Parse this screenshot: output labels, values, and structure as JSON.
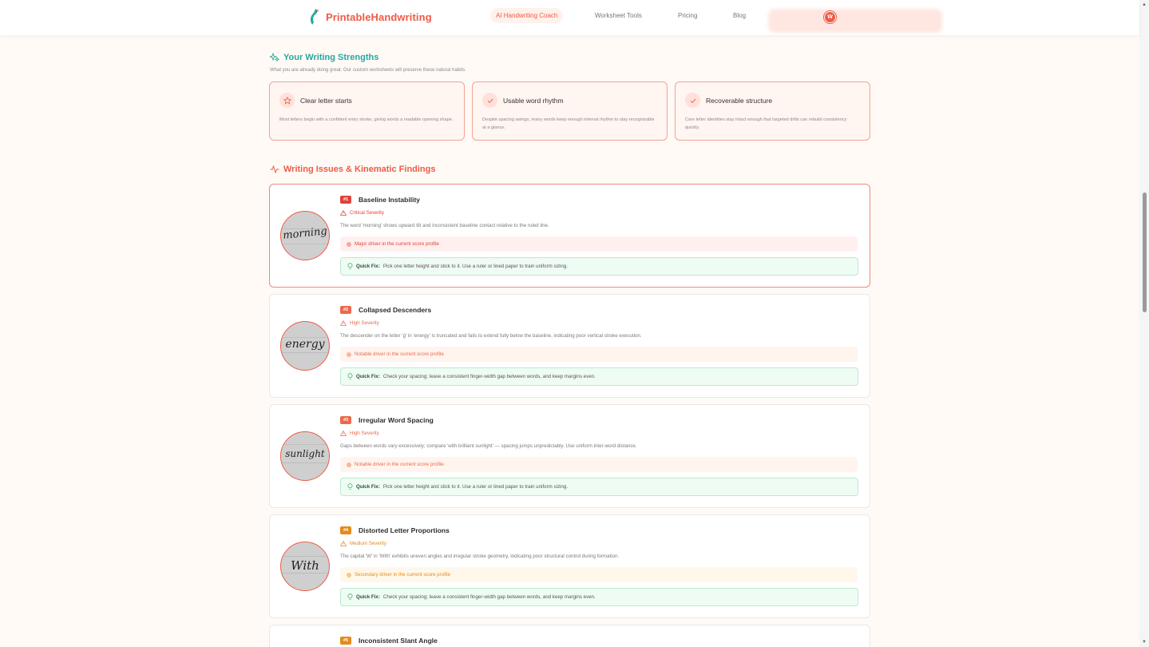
{
  "header": {
    "brand": "PrintableHandwriting",
    "nav": [
      {
        "label": "AI Handwriting Coach",
        "active": true
      },
      {
        "label": "Worksheet Tools",
        "active": false
      },
      {
        "label": "Pricing",
        "active": false
      },
      {
        "label": "Blog",
        "active": false
      }
    ],
    "avatar_initial": "W"
  },
  "strengths": {
    "title": "Your Writing Strengths",
    "subtitle": "What you are already doing great. Our custom worksheets will preserve these natural habits.",
    "items": [
      {
        "icon": "star-icon",
        "title": "Clear letter starts",
        "desc": "Most letters begin with a confident entry stroke, giving words a readable opening shape."
      },
      {
        "icon": "check-icon",
        "title": "Usable word rhythm",
        "desc": "Despite spacing swings, many words keep enough internal rhythm to stay recognizable at a glance."
      },
      {
        "icon": "check-icon",
        "title": "Recoverable structure",
        "desc": "Core letter identities stay intact enough that targeted drills can rebuild consistency quickly."
      }
    ]
  },
  "issues": {
    "title": "Writing Issues & Kinematic Findings",
    "quick_fix_label": "Quick Fix:",
    "items": [
      {
        "rank": "#1",
        "title": "Baseline Instability",
        "severity": "Critical Severity",
        "sample": "morning",
        "desc": "The word 'morning' shows upward tilt and inconsistent baseline contact relative to the ruled line.",
        "driver": "Major driver in the current score profile",
        "fix": "Pick one letter height and stick to it. Use a ruler or lined paper to train uniform sizing.",
        "level": "critical"
      },
      {
        "rank": "#2",
        "title": "Collapsed Descenders",
        "severity": "High Severity",
        "sample": "energy",
        "desc": "The descender on the letter 'g' in 'energy' is truncated and fails to extend fully below the baseline, indicating poor vertical stroke execution.",
        "driver": "Notable driver in the current score profile",
        "fix": "Check your spacing; leave a consistent finger-width gap between words, and keep margins even.",
        "level": "high"
      },
      {
        "rank": "#3",
        "title": "Irregular Word Spacing",
        "severity": "High Severity",
        "sample": "sunlight",
        "desc": "Gaps between words vary excessively; compare 'with brilliant sunlight' — spacing jumps unpredictably. Use uniform inter-word distance.",
        "driver": "Notable driver in the current score profile",
        "fix": "Pick one letter height and stick to it. Use a ruler or lined paper to train uniform sizing.",
        "level": "high"
      },
      {
        "rank": "#4",
        "title": "Distorted Letter Proportions",
        "severity": "Medium Severity",
        "sample": "With",
        "desc": "The capital 'W' in 'With' exhibits uneven angles and irregular stroke geometry, indicating poor structural control during formation.",
        "driver": "Secondary driver in the current score profile",
        "fix": "Check your spacing; leave a consistent finger-width gap between words, and keep margins even.",
        "level": "medium"
      },
      {
        "rank": "#5",
        "title": "Inconsistent Slant Angle",
        "severity": "",
        "sample": "",
        "desc": "",
        "driver": "",
        "fix": "",
        "level": "medium"
      }
    ]
  },
  "colors": {
    "brand": "#ef5a45",
    "teal": "#25a89e",
    "critical": "#e0413a",
    "high": "#ea6a4b",
    "medium": "#e58a1c",
    "fix_bg": "#effcf4"
  }
}
